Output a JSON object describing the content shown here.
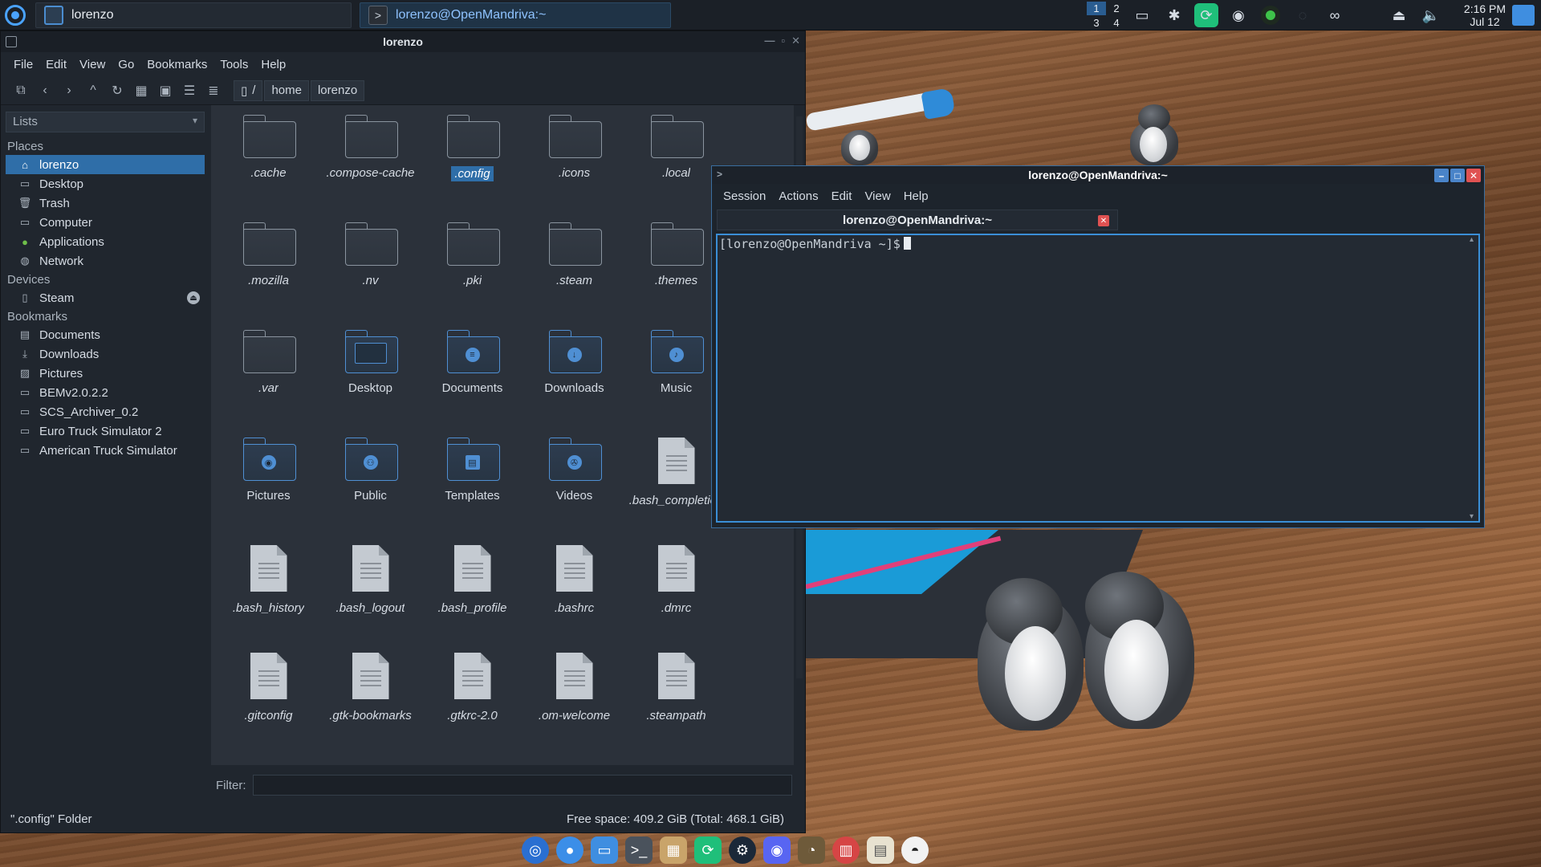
{
  "panel": {
    "tasks": [
      {
        "label": "lorenzo",
        "icon": "folder-icon"
      },
      {
        "label": "lorenzo@OpenMandriva:~",
        "icon": "terminal-icon"
      }
    ],
    "pager": [
      "1",
      "2",
      "3",
      "4"
    ],
    "clock_time": "2:16 PM",
    "clock_date": "Jul 12",
    "tray_icons": [
      "display-icon",
      "bluetooth-icon",
      "sync-icon",
      "discord-icon",
      "record-icon",
      "network-icon",
      "link-icon",
      "updates-icon",
      "volume-icon"
    ]
  },
  "file_manager": {
    "title": "lorenzo",
    "menu": [
      "File",
      "Edit",
      "View",
      "Go",
      "Bookmarks",
      "Tools",
      "Help"
    ],
    "breadcrumb": [
      "/",
      "home",
      "lorenzo"
    ],
    "sidebar_select": "Lists",
    "places_header": "Places",
    "places": [
      "lorenzo",
      "Desktop",
      "Trash",
      "Computer",
      "Applications",
      "Network"
    ],
    "devices_header": "Devices",
    "devices": [
      "Steam"
    ],
    "bookmarks_header": "Bookmarks",
    "bookmarks": [
      "Documents",
      "Downloads",
      "Pictures",
      "BEMv2.0.2.2",
      "SCS_Archiver_0.2",
      "Euro Truck Simulator 2",
      "American Truck Simulator"
    ],
    "files": [
      {
        "name": ".cache",
        "kind": "folder"
      },
      {
        "name": ".compose-cache",
        "kind": "folder"
      },
      {
        "name": ".config",
        "kind": "folder",
        "selected": true
      },
      {
        "name": ".icons",
        "kind": "folder"
      },
      {
        "name": ".local",
        "kind": "folder"
      },
      {
        "name": ".mozilla",
        "kind": "folder"
      },
      {
        "name": ".nv",
        "kind": "folder"
      },
      {
        "name": ".pki",
        "kind": "folder"
      },
      {
        "name": ".steam",
        "kind": "folder"
      },
      {
        "name": ".themes",
        "kind": "folder"
      },
      {
        "name": ".var",
        "kind": "folder"
      },
      {
        "name": "Desktop",
        "kind": "folder-desktop"
      },
      {
        "name": "Documents",
        "kind": "folder-documents"
      },
      {
        "name": "Downloads",
        "kind": "folder-downloads"
      },
      {
        "name": "Music",
        "kind": "folder-music"
      },
      {
        "name": "Pictures",
        "kind": "folder-pictures"
      },
      {
        "name": "Public",
        "kind": "folder-public"
      },
      {
        "name": "Templates",
        "kind": "folder-templates"
      },
      {
        "name": "Videos",
        "kind": "folder-videos"
      },
      {
        "name": ".bash_completion",
        "kind": "file"
      },
      {
        "name": ".bash_history",
        "kind": "file"
      },
      {
        "name": ".bash_logout",
        "kind": "file"
      },
      {
        "name": ".bash_profile",
        "kind": "file"
      },
      {
        "name": ".bashrc",
        "kind": "file"
      },
      {
        "name": ".dmrc",
        "kind": "file"
      },
      {
        "name": ".gitconfig",
        "kind": "file"
      },
      {
        "name": ".gtk-bookmarks",
        "kind": "file"
      },
      {
        "name": ".gtkrc-2.0",
        "kind": "file"
      },
      {
        "name": ".om-welcome",
        "kind": "file"
      },
      {
        "name": ".steampath",
        "kind": "file-link"
      }
    ],
    "filter_label": "Filter:",
    "filter_value": "",
    "status_left": "\".config\" Folder",
    "status_right": "Free space: 409.2 GiB (Total: 468.1 GiB)"
  },
  "konsole": {
    "title": "lorenzo@OpenMandriva:~",
    "menu": [
      "Session",
      "Actions",
      "Edit",
      "View",
      "Help"
    ],
    "tab_label": "lorenzo@OpenMandriva:~",
    "prompt": "[lorenzo@OpenMandriva ~]$"
  },
  "dock": [
    "browser-icon",
    "chromium-icon",
    "files-icon",
    "terminal-icon",
    "archive-icon",
    "sync-icon",
    "steam-icon",
    "discord-icon",
    "gimp-icon",
    "reader-icon",
    "document-viewer-icon",
    "github-icon"
  ],
  "colors": {
    "accent": "#2f6ea8",
    "terminal_border": "#3a8ed6",
    "close": "#e05252"
  }
}
